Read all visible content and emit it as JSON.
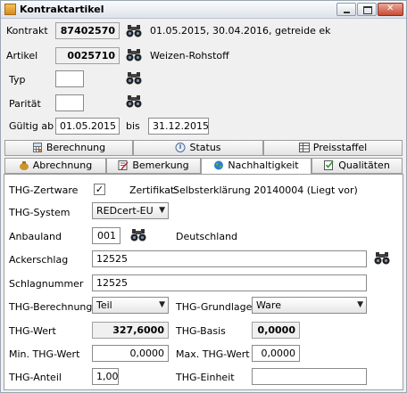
{
  "window": {
    "title": "Kontraktartikel"
  },
  "header": {
    "kontrakt_label": "Kontrakt",
    "kontrakt_value": "87402570",
    "kontrakt_desc": "01.05.2015, 30.04.2016, getreide ek",
    "artikel_label": "Artikel",
    "artikel_value": "0025710",
    "artikel_desc": "Weizen-Rohstoff",
    "typ_label": "Typ",
    "typ_value": "",
    "paritaet_label": "Parität",
    "paritaet_value": "",
    "gueltig_label": "Gültig ab",
    "gueltig_from": "01.05.2015",
    "bis_label": "bis",
    "gueltig_to": "31.12.2015"
  },
  "tabs_row1": [
    {
      "label": "Berechnung",
      "icon": "calculator-icon"
    },
    {
      "label": "Status",
      "icon": "status-icon"
    },
    {
      "label": "Preisstaffel",
      "icon": "table-icon"
    }
  ],
  "tabs_row2": [
    {
      "label": "Abrechnung",
      "icon": "money-bag-icon"
    },
    {
      "label": "Bemerkung",
      "icon": "note-icon"
    },
    {
      "label": "Nachhaltigkeit",
      "icon": "globe-icon",
      "active": true
    },
    {
      "label": "Qualitäten",
      "icon": "quality-icon"
    }
  ],
  "nachhaltigkeit": {
    "thg_zertware_label": "THG-Zertware",
    "thg_zertware_checked": true,
    "zertifikat_label": "Zertifikat:",
    "zertifikat_value": "Selbsterklärung 20140004 (Liegt vor)",
    "thg_system_label": "THG-System",
    "thg_system_value": "REDcert-EU",
    "anbauland_label": "Anbauland",
    "anbauland_code": "001",
    "anbauland_name": "Deutschland",
    "ackerschlag_label": "Ackerschlag",
    "ackerschlag_value": "12525",
    "schlagnummer_label": "Schlagnummer",
    "schlagnummer_value": "12525",
    "thg_berechnung_label": "THG-Berechnung",
    "thg_berechnung_value": "Teil",
    "thg_grundlage_label": "THG-Grundlage",
    "thg_grundlage_value": "Ware",
    "thg_wert_label": "THG-Wert",
    "thg_wert_value": "327,6000",
    "thg_basis_label": "THG-Basis",
    "thg_basis_value": "0,0000",
    "min_thg_wert_label": "Min. THG-Wert",
    "min_thg_wert_value": "0,0000",
    "max_thg_wert_label": "Max. THG-Wert",
    "max_thg_wert_value": "0,0000",
    "thg_anteil_label": "THG-Anteil",
    "thg_anteil_value": "1,00",
    "thg_einheit_label": "THG-Einheit",
    "thg_einheit_value": ""
  },
  "colors": {
    "active_tab_bg": "#ffffff",
    "titlebar_close": "#c84b33"
  }
}
